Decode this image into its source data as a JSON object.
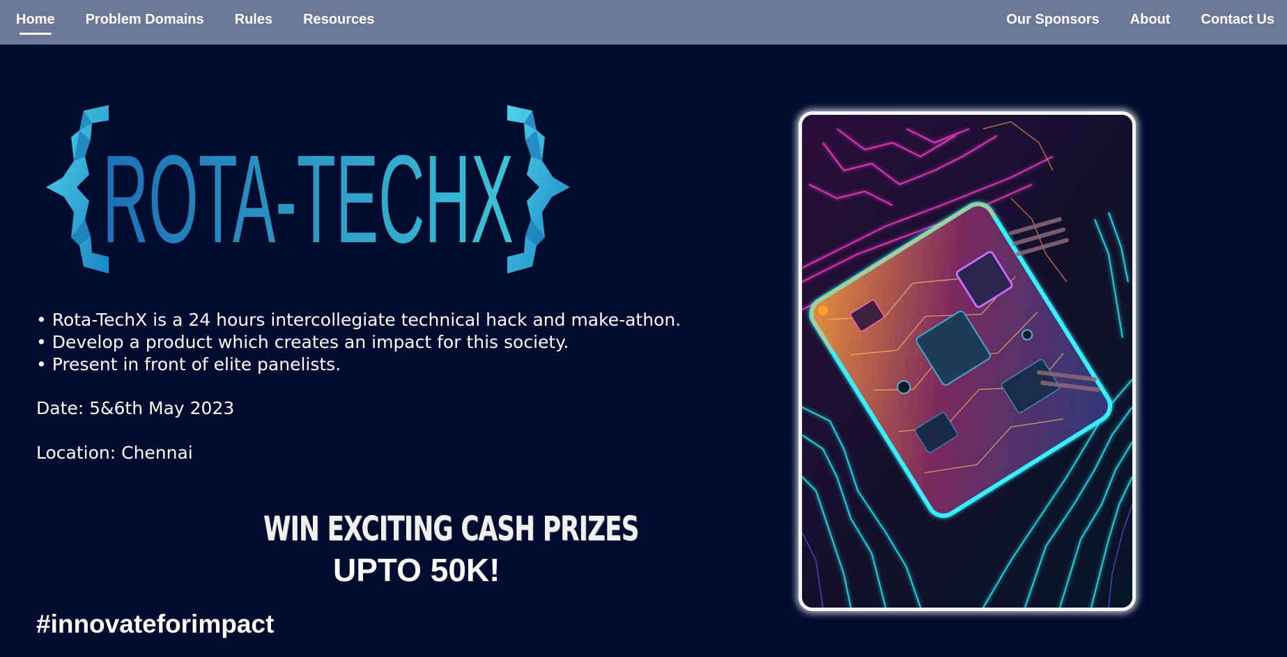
{
  "nav": {
    "left": [
      {
        "label": "Home"
      },
      {
        "label": "Problem Domains"
      },
      {
        "label": "Rules"
      },
      {
        "label": "Resources"
      }
    ],
    "right": [
      {
        "label": "Our Sponsors"
      },
      {
        "label": "About"
      },
      {
        "label": "Contact Us"
      }
    ],
    "active": "Home"
  },
  "logo": {
    "text": "ROTA-TECHX"
  },
  "bullets": [
    "• Rota-TechX is a 24 hours intercollegiate technical hack and make-athon.",
    "• Develop a product which creates an impact for this society.",
    "• Present in front of elite panelists."
  ],
  "info": {
    "date": "Date: 5&6th May 2023",
    "location": "Location: Chennai"
  },
  "prize": {
    "line1": "WIN EXCITING CASH PRIZES",
    "line2": "UPTO 50K!"
  },
  "hashtag": "#innovateforimpact",
  "colors": {
    "background": "#000c2e",
    "navbar": "#6b7896",
    "logo_blue": "#1e6fb4",
    "logo_cyan": "#3cc3d6"
  }
}
